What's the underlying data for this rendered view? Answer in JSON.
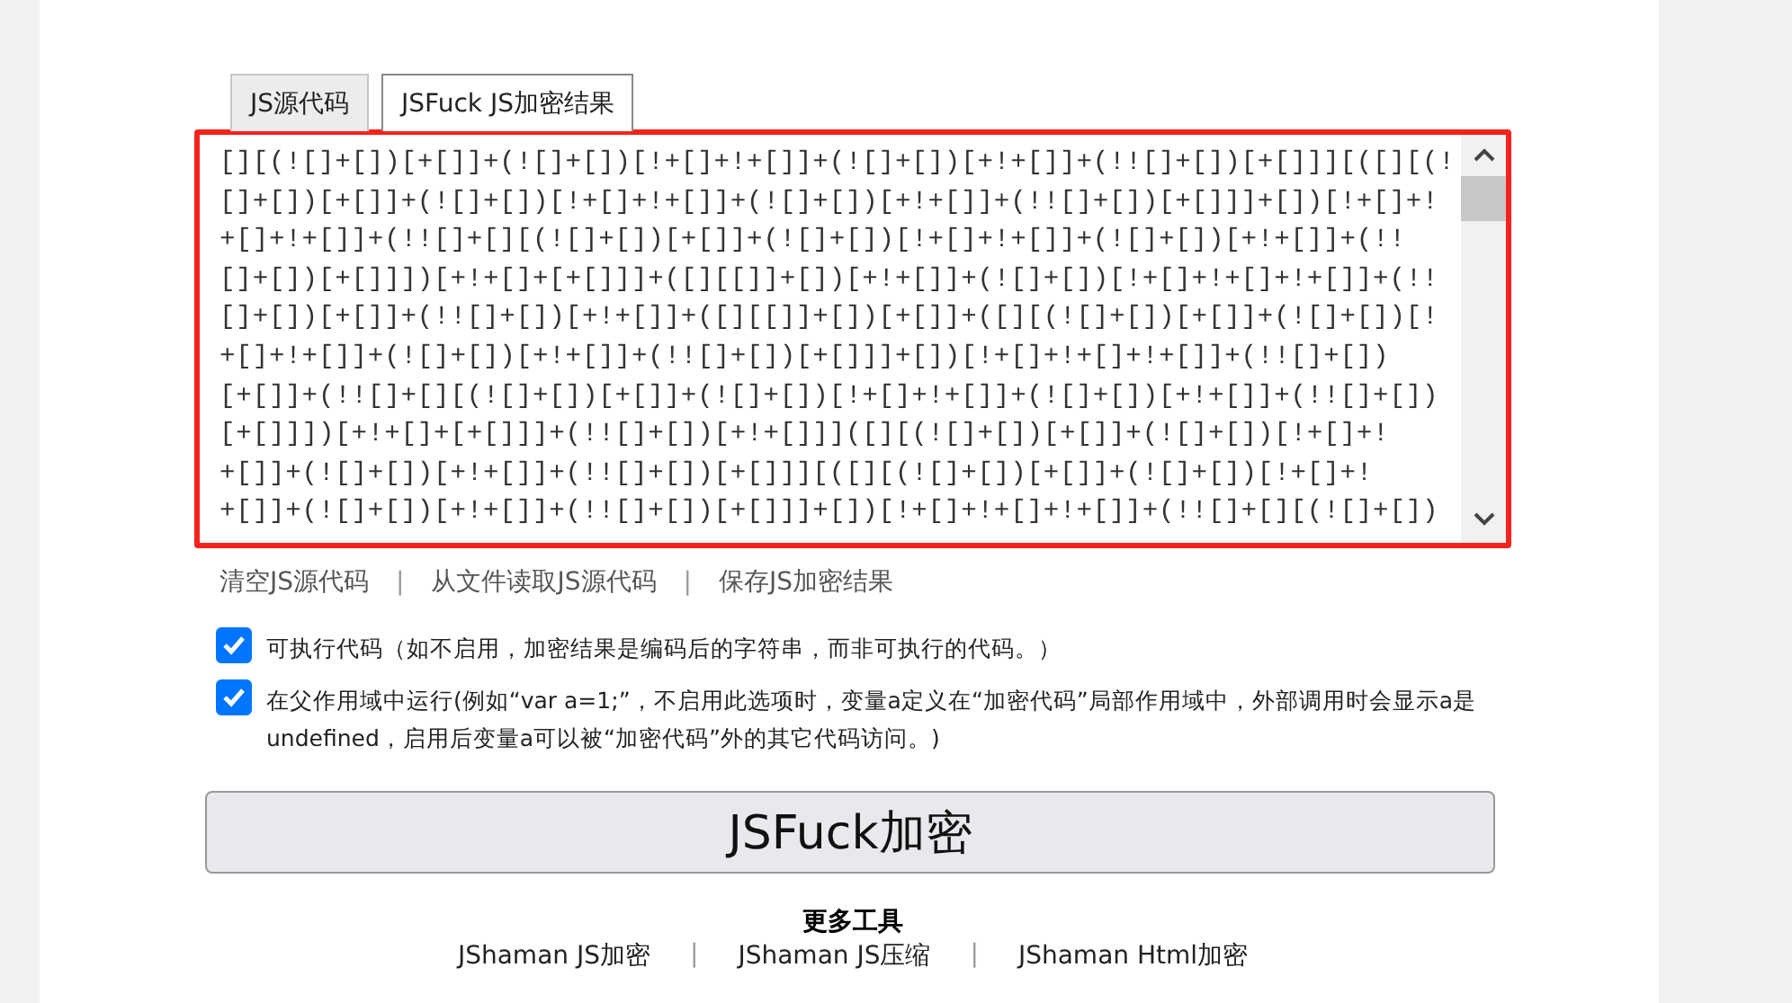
{
  "tabs": [
    {
      "label": "JS源代码",
      "selected": false
    },
    {
      "label": "JSFuck JS加密结果",
      "selected": true
    }
  ],
  "code_field": {
    "highlighted": true,
    "lines": [
      "[][(![]+[])[+[]]+(![]+[])[!+[]+!+[]]+(![]+[])[+!+[]]+(!![]+[])[+[]]][([][(!",
      "[]+[])[+[]]+(![]+[])[!+[]+!+[]]+(![]+[])[+!+[]]+(!![]+[])[+[]]]+[])[!+[]+!",
      "+[]+!+[]]+(!![]+[][(![]+[])[+[]]+(![]+[])[!+[]+!+[]]+(![]+[])[+!+[]]+(!!",
      "[]+[])[+[]]])[+!+[]+[+[]]]+([][[]]+[])[+!+[]]+(![]+[])[!+[]+!+[]+!+[]]+(!!",
      "[]+[])[+[]]+(!![]+[])[+!+[]]+([][[]]+[])[+[]]+([][(![]+[])[+[]]+(![]+[])[!",
      "+[]+!+[]]+(![]+[])[+!+[]]+(!![]+[])[+[]]]+[])[!+[]+!+[]+!+[]]+(!![]+[])",
      "[+[]]+(!![]+[][(![]+[])[+[]]+(![]+[])[!+[]+!+[]]+(![]+[])[+!+[]]+(!![]+[])",
      "[+[]]])[+!+[]+[+[]]]+(!![]+[])[+!+[]]]([][(![]+[])[+[]]+(![]+[])[!+[]+!",
      "+[]]+(![]+[])[+!+[]]+(!![]+[])[+[]]][([][(![]+[])[+[]]+(![]+[])[!+[]+!",
      "+[]]+(![]+[])[+!+[]]+(!![]+[])[+[]]]+[])[!+[]+!+[]+!+[]]+(!![]+[][(![]+[])"
    ]
  },
  "actions": [
    {
      "kind": "link",
      "text": "清空JS源代码"
    },
    {
      "kind": "separator",
      "text": "|"
    },
    {
      "kind": "link",
      "text": "从文件读取JS源代码"
    },
    {
      "kind": "separator",
      "text": "|"
    },
    {
      "kind": "link",
      "text": "保存JS加密结果"
    }
  ],
  "options": [
    {
      "label": "可执行代码（如不启用，加密结果是编码后的字符串，而非可执行的代码。）",
      "checked": true
    },
    {
      "label": "在父作用域中运行(例如“var a=1;”，不启用此选项时，变量a定义在“加密代码”局部作用域中，外部调用时会显示a是undefined，启用后变量a可以被“加密代码”外的其它代码访问。)",
      "checked": true
    }
  ],
  "submit_button": "JSFuck加密",
  "more_tools": {
    "title": "更多工具",
    "links": [
      {
        "kind": "link",
        "text": "JShaman JS加密"
      },
      {
        "kind": "separator",
        "text": "|"
      },
      {
        "kind": "link",
        "text": "JShaman JS压缩"
      },
      {
        "kind": "separator",
        "text": "|"
      },
      {
        "kind": "link",
        "text": "JShaman Html加密"
      }
    ]
  }
}
